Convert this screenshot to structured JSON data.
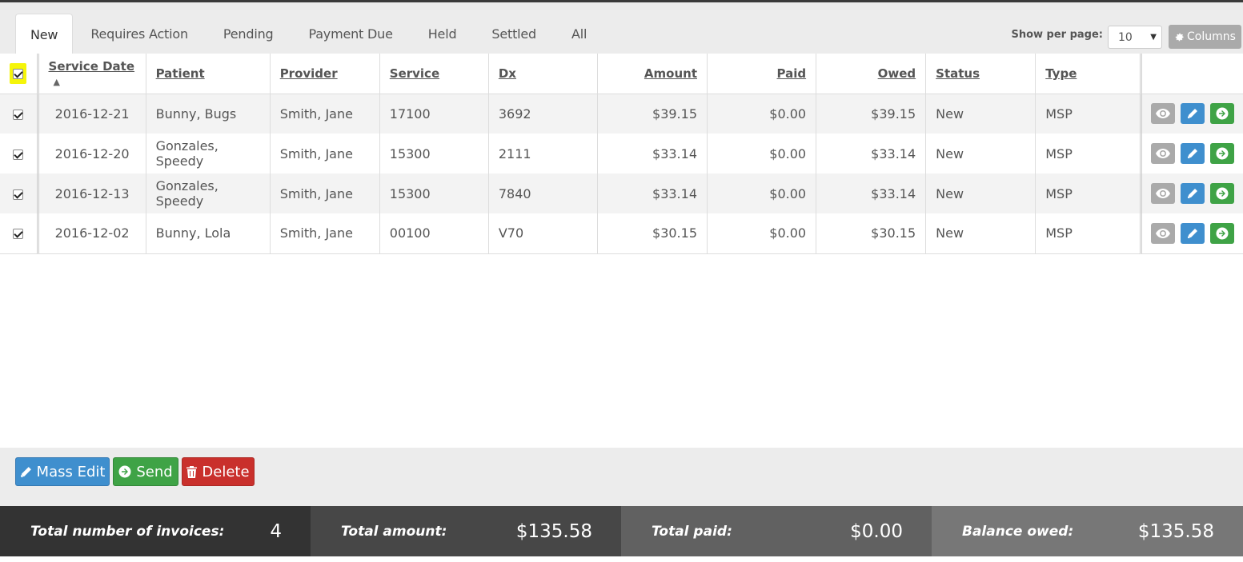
{
  "tabs": [
    "New",
    "Requires Action",
    "Pending",
    "Payment Due",
    "Held",
    "Settled",
    "All"
  ],
  "active_tab": "New",
  "toolbar": {
    "per_page_label": "Show per page:",
    "per_page_value": "10",
    "columns_label": "Columns"
  },
  "table": {
    "columns": [
      "Service Date",
      "Patient",
      "Provider",
      "Service",
      "Dx",
      "Amount",
      "Paid",
      "Owed",
      "Status",
      "Type"
    ],
    "rows": [
      {
        "date": "2016-12-21",
        "patient": "Bunny, Bugs",
        "provider": "Smith, Jane",
        "service": "17100",
        "dx": "3692",
        "amount": "$39.15",
        "paid": "$0.00",
        "owed": "$39.15",
        "status": "New",
        "type": "MSP"
      },
      {
        "date": "2016-12-20",
        "patient": "Gonzales, Speedy",
        "provider": "Smith, Jane",
        "service": "15300",
        "dx": "2111",
        "amount": "$33.14",
        "paid": "$0.00",
        "owed": "$33.14",
        "status": "New",
        "type": "MSP"
      },
      {
        "date": "2016-12-13",
        "patient": "Gonzales, Speedy",
        "provider": "Smith, Jane",
        "service": "15300",
        "dx": "7840",
        "amount": "$33.14",
        "paid": "$0.00",
        "owed": "$33.14",
        "status": "New",
        "type": "MSP"
      },
      {
        "date": "2016-12-02",
        "patient": "Bunny, Lola",
        "provider": "Smith, Jane",
        "service": "00100",
        "dx": "V70",
        "amount": "$30.15",
        "paid": "$0.00",
        "owed": "$30.15",
        "status": "New",
        "type": "MSP"
      }
    ]
  },
  "actions": {
    "mass_edit": "Mass Edit",
    "send": "Send",
    "delete": "Delete"
  },
  "totals": {
    "count_label": "Total number of invoices:",
    "count_value": "4",
    "amount_label": "Total amount:",
    "amount_value": "$135.58",
    "paid_label": "Total paid:",
    "paid_value": "$0.00",
    "owed_label": "Balance owed:",
    "owed_value": "$135.58"
  },
  "colors": {
    "primary": "#3f8fce",
    "success": "#3fa346",
    "danger": "#c9302c",
    "highlight": "#f5f50a"
  }
}
